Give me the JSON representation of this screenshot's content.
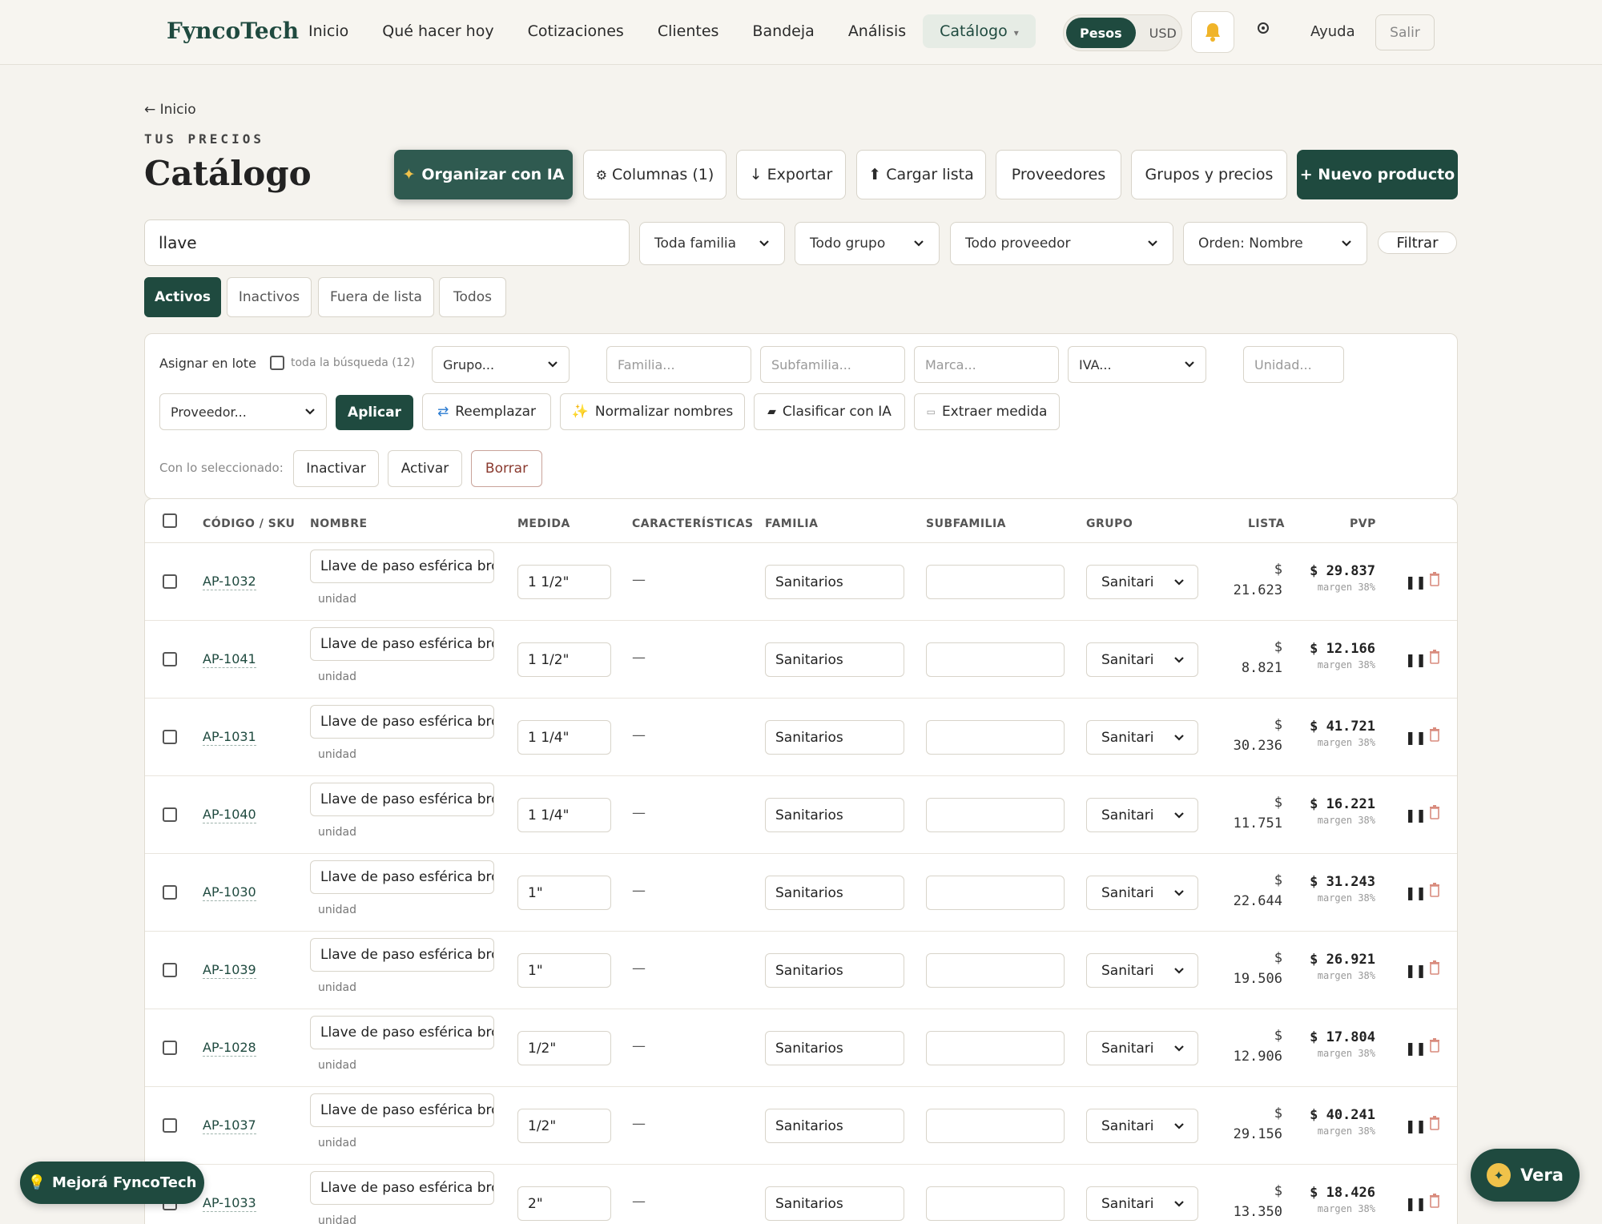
{
  "nav": {
    "brand": "FyncoTech",
    "links": [
      "Inicio",
      "Qué hacer hoy",
      "Cotizaciones",
      "Clientes",
      "Bandeja",
      "Análisis",
      "Catálogo"
    ],
    "active_caret": "▾",
    "currency": [
      "Pesos",
      "USD"
    ],
    "help": "Ayuda",
    "logout": "Salir"
  },
  "header": {
    "back": "← Inicio",
    "eyebrow": "TUS PRECIOS",
    "title": "Catálogo",
    "buttons": {
      "ai": "Organizar con IA",
      "columns": "Columnas (1)",
      "export": "↓ Exportar",
      "upload": "⬆ Cargar lista",
      "suppliers": "Proveedores",
      "groups": "Grupos y precios",
      "new": "+ Nuevo producto"
    }
  },
  "filters": {
    "search_value": "llave",
    "family": "Toda familia",
    "group": "Todo grupo",
    "supplier": "Todo proveedor",
    "order": "Orden: Nombre",
    "filter_button": "Filtrar"
  },
  "tabs": [
    "Activos",
    "Inactivos",
    "Fuera de lista",
    "Todos"
  ],
  "bulk": {
    "label": "Asignar en lote",
    "all_search": "toda la búsqueda (12)",
    "group_placeholder": "Grupo...",
    "family_placeholder": "Familia...",
    "subfamily_placeholder": "Subfamilia...",
    "brand_placeholder": "Marca...",
    "iva_placeholder": "IVA...",
    "unit_placeholder": "Unidad...",
    "supplier_placeholder": "Proveedor...",
    "apply": "Aplicar",
    "replace": "Reemplazar",
    "normalize": "Normalizar nombres",
    "classify": "Clasificar con IA",
    "extract": "Extraer medida",
    "with_selected": "Con lo seleccionado:",
    "inactivate": "Inactivar",
    "activate": "Activar",
    "delete": "Borrar"
  },
  "table": {
    "headers": {
      "sku": "CÓDIGO / SKU",
      "name": "NOMBRE",
      "measure": "MEDIDA",
      "features": "CARACTERÍSTICAS",
      "family": "FAMILIA",
      "subfamily": "SUBFAMILIA",
      "group": "GRUPO",
      "list": "LISTA",
      "pvp": "PVP"
    },
    "rows": [
      {
        "sku": "AP-1032",
        "name": "Llave de paso esférica bronce",
        "unit": "unidad",
        "measure": "1 1/2\"",
        "features": "—",
        "family": "Sanitarios",
        "subfamily": "",
        "group": "Sanitari",
        "list_cur": "$",
        "list": "21.623",
        "pvp": "$ 29.837",
        "margin": "margen 38%"
      },
      {
        "sku": "AP-1041",
        "name": "Llave de paso esférica bronce",
        "unit": "unidad",
        "measure": "1 1/2\"",
        "features": "—",
        "family": "Sanitarios",
        "subfamily": "",
        "group": "Sanitari",
        "list_cur": "$",
        "list": "8.821",
        "pvp": "$ 12.166",
        "margin": "margen 38%"
      },
      {
        "sku": "AP-1031",
        "name": "Llave de paso esférica bronce",
        "unit": "unidad",
        "measure": "1 1/4\"",
        "features": "—",
        "family": "Sanitarios",
        "subfamily": "",
        "group": "Sanitari",
        "list_cur": "$",
        "list": "30.236",
        "pvp": "$ 41.721",
        "margin": "margen 38%"
      },
      {
        "sku": "AP-1040",
        "name": "Llave de paso esférica bronce",
        "unit": "unidad",
        "measure": "1 1/4\"",
        "features": "—",
        "family": "Sanitarios",
        "subfamily": "",
        "group": "Sanitari",
        "list_cur": "$",
        "list": "11.751",
        "pvp": "$ 16.221",
        "margin": "margen 38%"
      },
      {
        "sku": "AP-1030",
        "name": "Llave de paso esférica bronce",
        "unit": "unidad",
        "measure": "1\"",
        "features": "—",
        "family": "Sanitarios",
        "subfamily": "",
        "group": "Sanitari",
        "list_cur": "$",
        "list": "22.644",
        "pvp": "$ 31.243",
        "margin": "margen 38%"
      },
      {
        "sku": "AP-1039",
        "name": "Llave de paso esférica bronce",
        "unit": "unidad",
        "measure": "1\"",
        "features": "—",
        "family": "Sanitarios",
        "subfamily": "",
        "group": "Sanitari",
        "list_cur": "$",
        "list": "19.506",
        "pvp": "$ 26.921",
        "margin": "margen 38%"
      },
      {
        "sku": "AP-1028",
        "name": "Llave de paso esférica bronce",
        "unit": "unidad",
        "measure": "1/2\"",
        "features": "—",
        "family": "Sanitarios",
        "subfamily": "",
        "group": "Sanitari",
        "list_cur": "$",
        "list": "12.906",
        "pvp": "$ 17.804",
        "margin": "margen 38%"
      },
      {
        "sku": "AP-1037",
        "name": "Llave de paso esférica bronce",
        "unit": "unidad",
        "measure": "1/2\"",
        "features": "—",
        "family": "Sanitarios",
        "subfamily": "",
        "group": "Sanitari",
        "list_cur": "$",
        "list": "29.156",
        "pvp": "$ 40.241",
        "margin": "margen 38%"
      },
      {
        "sku": "AP-1033",
        "name": "Llave de paso esférica bronce",
        "unit": "unidad",
        "measure": "2\"",
        "features": "—",
        "family": "Sanitarios",
        "subfamily": "",
        "group": "Sanitari",
        "list_cur": "$",
        "list": "13.350",
        "pvp": "$ 18.426",
        "margin": "margen 38%"
      }
    ]
  },
  "floating": {
    "improve": "Mejorá FyncoTech",
    "assistant": "Vera"
  },
  "colors": {
    "brand": "#1f4a3f",
    "background": "#f5f3ee",
    "danger": "#c0392b"
  }
}
